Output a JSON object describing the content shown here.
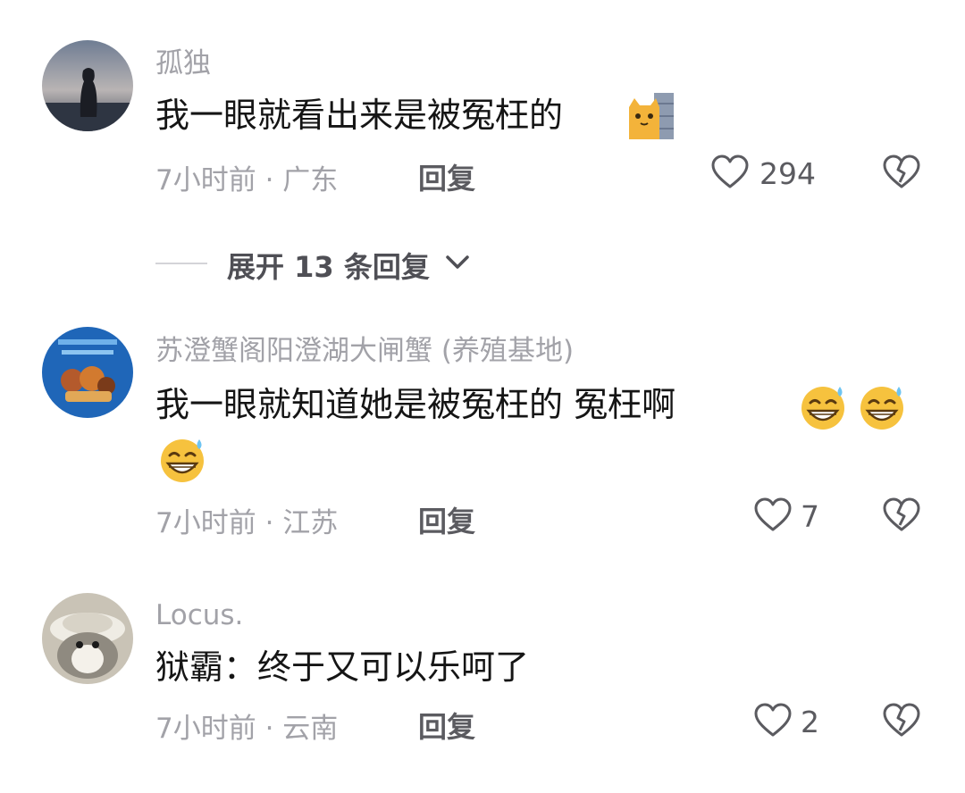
{
  "comments": [
    {
      "username": "孤独",
      "text": "我一眼就看出来是被冤枉的",
      "emoji": "cat-peeking-emoji",
      "meta": "7小时前 · 广东",
      "reply": "回复",
      "likes": "294"
    },
    {
      "username": "苏澄蟹阁阳澄湖大闸蟹 (养殖基地)",
      "text": "我一眼就知道她是被冤枉的  冤枉啊",
      "emoji": "grinning-sweat-emoji",
      "meta": "7小时前 · 江苏",
      "reply": "回复",
      "likes": "7"
    },
    {
      "username": "Locus.",
      "text": "狱霸：终于又可以乐呵了",
      "meta": "7小时前 · 云南",
      "reply": "回复",
      "likes": "2"
    }
  ],
  "expand_replies": {
    "label": "展开 13 条回复",
    "icon": "chevron-down-icon"
  },
  "icons": {
    "like": "heart-outline-icon",
    "dislike": "broken-heart-icon"
  },
  "colors": {
    "text": "#151515",
    "secondary": "#a2a2a8",
    "action": "#5b5b60",
    "emoji": "#f6c23e"
  }
}
